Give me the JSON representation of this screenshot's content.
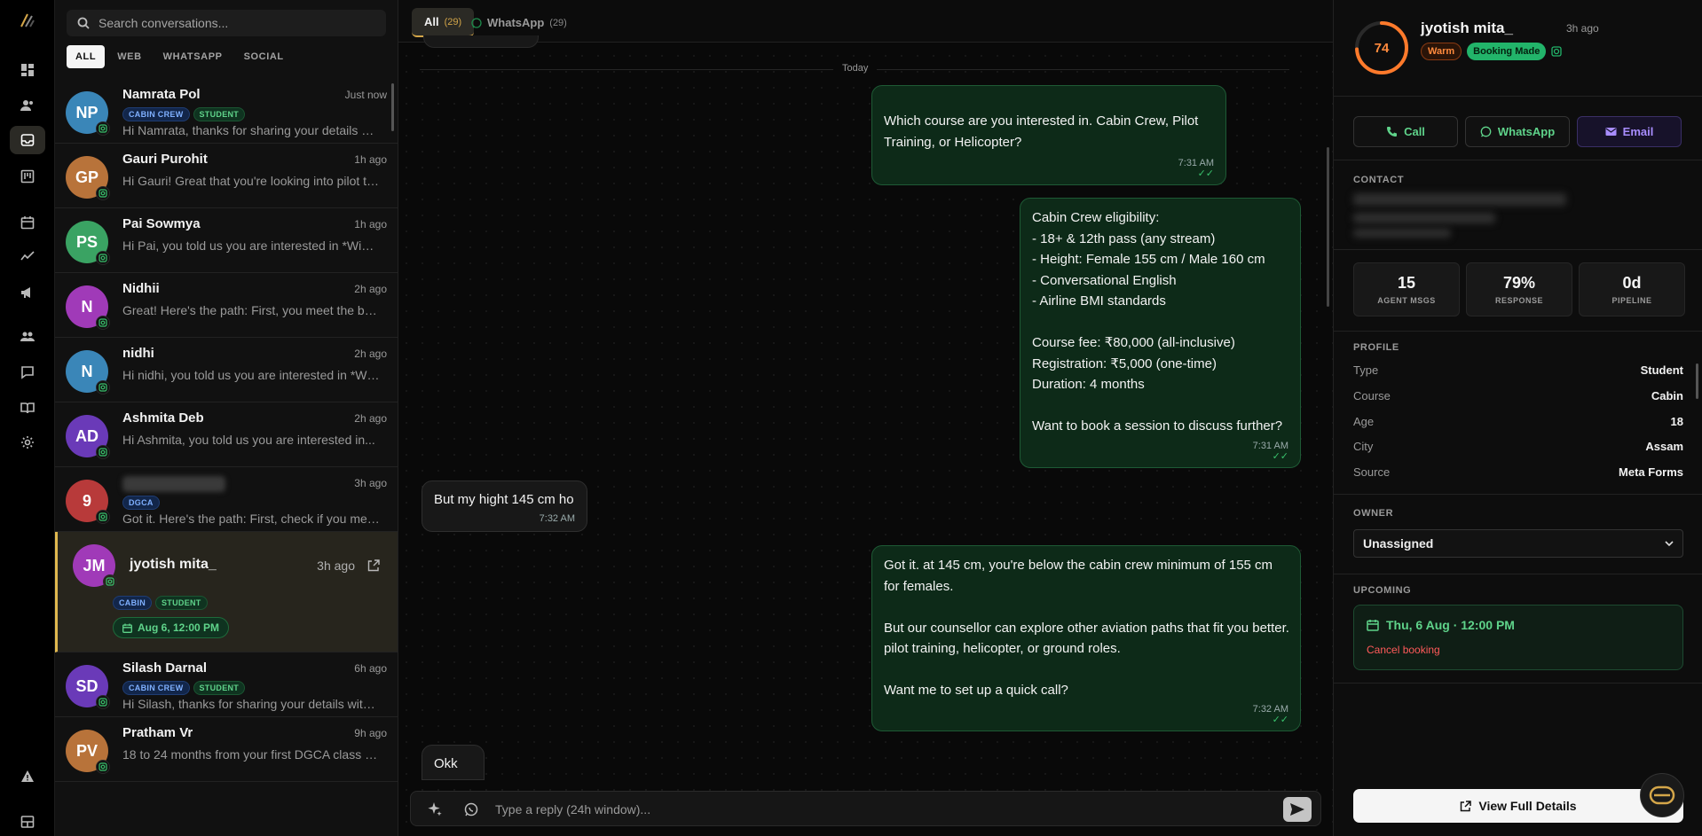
{
  "search": {
    "placeholder": "Search conversations..."
  },
  "filters": [
    "ALL",
    "WEB",
    "WHATSAPP",
    "SOCIAL"
  ],
  "conversations": [
    {
      "initials": "NP",
      "name": "Namrata Pol",
      "time": "Just now",
      "tags": [
        "CABIN CREW",
        "STUDENT"
      ],
      "preview": "Hi Namrata, thanks for sharing your details with us...",
      "color": "#3a86b8"
    },
    {
      "initials": "GP",
      "name": "Gauri Purohit",
      "time": "1h ago",
      "tags": [],
      "preview": "Hi Gauri! Great that you're looking into pilot training...",
      "color": "#b8733a"
    },
    {
      "initials": "PS",
      "name": "Pai Sowmya",
      "time": "1h ago",
      "tags": [],
      "preview": "Hi Pai, you told us you are interested in *Wings...",
      "color": "#3aa363"
    },
    {
      "initials": "N",
      "name": "Nidhii",
      "time": "2h ago",
      "tags": [],
      "preview": "Great! Here's the path: First, you meet the basic...",
      "color": "#a03ab8"
    },
    {
      "initials": "N",
      "name": "nidhi",
      "time": "2h ago",
      "tags": [],
      "preview": "Hi nidhi, you told us you are interested in *Wings...",
      "color": "#3a86b8"
    },
    {
      "initials": "AD",
      "name": "Ashmita Deb",
      "time": "2h ago",
      "tags": [],
      "preview": "Hi Ashmita, you told us you are interested in...",
      "color": "#6a3ab8"
    },
    {
      "initials": "9",
      "name": "",
      "time": "3h ago",
      "tags": [
        "DGCA"
      ],
      "preview": "Got it. Here's the path: First, check if you meet...",
      "color": "#b83a3a"
    },
    {
      "initials": "JM",
      "name": "jyotish mita_",
      "time": "3h ago",
      "tags": [
        "CABIN",
        "STUDENT"
      ],
      "booking": "Aug 6, 12:00 PM",
      "color": "#a03ab8"
    },
    {
      "initials": "SD",
      "name": "Silash Darnal",
      "time": "6h ago",
      "tags": [
        "CABIN CREW",
        "STUDENT"
      ],
      "preview": "Hi Silash, thanks for sharing your details with us...",
      "color": "#6a3ab8"
    },
    {
      "initials": "PV",
      "name": "Pratham Vr",
      "time": "9h ago",
      "tags": [],
      "preview": "18 to 24 months from your first DGCA class to...",
      "color": "#b8733a"
    }
  ],
  "chat": {
    "tabs": [
      {
        "label": "All",
        "count": "(29)"
      },
      {
        "label": "WhatsApp",
        "count": "(29)"
      }
    ],
    "separator": "Today",
    "messages": [
      {
        "dir": "out",
        "text": "Which course are you interested in. Cabin Crew, Pilot Training, or Helicopter?",
        "time": "7:31 AM"
      },
      {
        "dir": "out",
        "text": "Cabin Crew eligibility:\n- 18+ & 12th pass (any stream)\n- Height: Female 155 cm / Male 160 cm\n- Conversational English\n- Airline BMI standards\n\nCourse fee: ₹80,000 (all-inclusive)\nRegistration: ₹5,000 (one-time)\nDuration: 4 months\n\nWant to book a session to discuss further?",
        "time": "7:31 AM"
      },
      {
        "dir": "in",
        "text": "But my hight 145 cm ho",
        "time": "7:32 AM"
      },
      {
        "dir": "out",
        "text": "Got it. at 145 cm, you're below the cabin crew minimum of 155 cm for females.\n\nBut our counsellor can explore other aviation paths that fit you better. pilot training, helicopter, or ground roles.\n\nWant me to set up a quick call?",
        "time": "7:32 AM"
      },
      {
        "dir": "in",
        "text": "Okk",
        "time": ""
      }
    ],
    "composer_placeholder": "Type a reply (24h window)..."
  },
  "profile": {
    "score": "74",
    "score_fraction": 0.74,
    "name": "jyotish mita_",
    "ago": "3h ago",
    "tags": [
      "Warm",
      "Booking Made"
    ],
    "actions": [
      "Call",
      "WhatsApp",
      "Email"
    ],
    "contact_heading": "CONTACT",
    "stats": [
      {
        "value": "15",
        "label": "AGENT MSGS"
      },
      {
        "value": "79%",
        "label": "RESPONSE"
      },
      {
        "value": "0d",
        "label": "PIPELINE"
      }
    ],
    "profile_heading": "PROFILE",
    "fields": [
      {
        "k": "Type",
        "v": "Student"
      },
      {
        "k": "Course",
        "v": "Cabin"
      },
      {
        "k": "Age",
        "v": "18"
      },
      {
        "k": "City",
        "v": "Assam"
      },
      {
        "k": "Source",
        "v": "Meta Forms"
      }
    ],
    "owner_heading": "OWNER",
    "owner_value": "Unassigned",
    "upcoming_heading": "UPCOMING",
    "upcoming_date": "Thu, 6 Aug · 12:00 PM",
    "cancel_label": "Cancel booking",
    "view_full": "View Full Details"
  },
  "colors": {
    "accent": "#e0b84f",
    "green": "#5fd38a",
    "warm": "#ff8a3d"
  }
}
